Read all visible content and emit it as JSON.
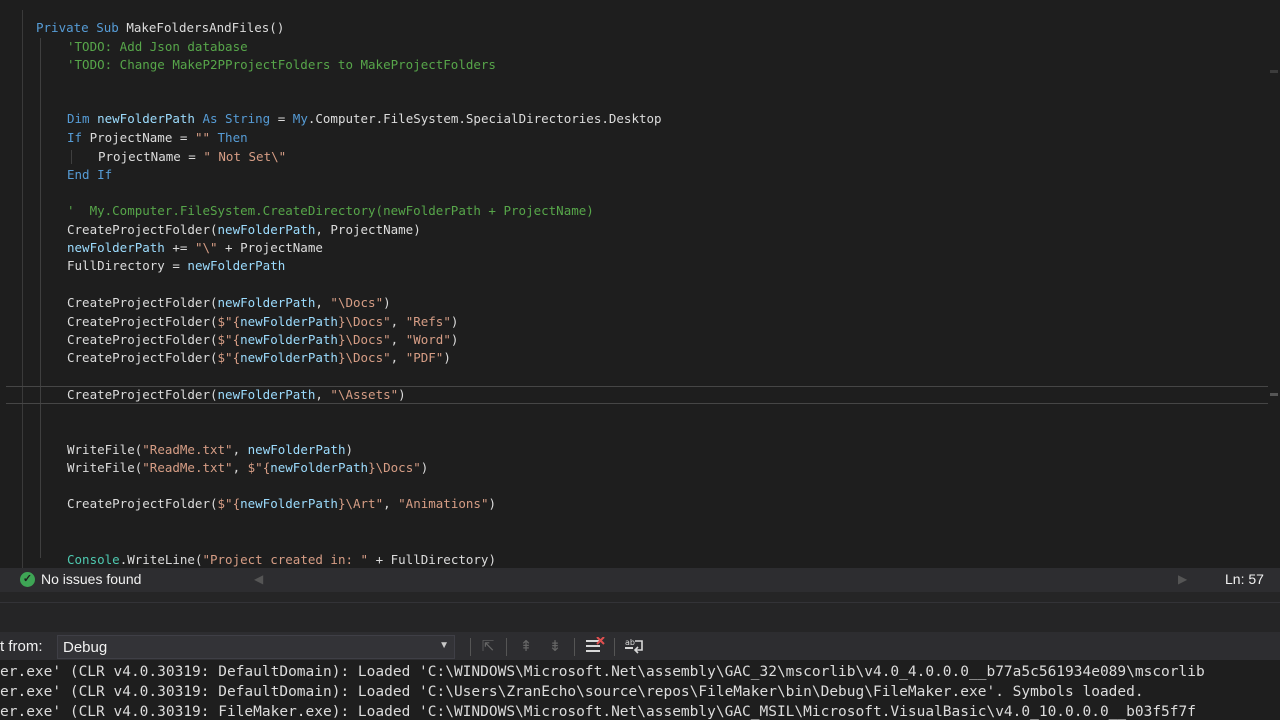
{
  "editor": {
    "lines": [
      {
        "segs": [
          [
            "kw",
            "Private Sub "
          ],
          [
            "tx",
            "MakeFoldersAndFiles()"
          ]
        ]
      },
      {
        "segs": [
          [
            "cm",
            "'TODO: Add Json database"
          ]
        ]
      },
      {
        "segs": [
          [
            "cm",
            "'TODO: Change MakeP2PProjectFolders to MakeProjectFolders"
          ]
        ]
      },
      {
        "segs": [
          [
            "kw",
            "Dim "
          ],
          [
            "id",
            "newFolderPath "
          ],
          [
            "kw",
            "As "
          ],
          [
            "kw",
            "String "
          ],
          [
            "tx",
            "= "
          ],
          [
            "kw",
            "My"
          ],
          [
            "tx",
            ".Computer.FileSystem.SpecialDirectories.Desktop"
          ]
        ]
      },
      {
        "segs": [
          [
            "kw",
            "If "
          ],
          [
            "tx",
            "ProjectName = "
          ],
          [
            "str",
            "\"\" "
          ],
          [
            "kw",
            "Then"
          ]
        ]
      },
      {
        "segs": [
          [
            "tx",
            "ProjectName = "
          ],
          [
            "str",
            "\" Not Set\\\""
          ]
        ]
      },
      {
        "segs": [
          [
            "kw",
            "End If"
          ]
        ]
      },
      {
        "segs": [
          [
            "cm",
            "'  My.Computer.FileSystem.CreateDirectory(newFolderPath + ProjectName)"
          ]
        ]
      },
      {
        "segs": [
          [
            "tx",
            "CreateProjectFolder("
          ],
          [
            "id",
            "newFolderPath"
          ],
          [
            "tx",
            ", ProjectName)"
          ]
        ]
      },
      {
        "segs": [
          [
            "id",
            "newFolderPath "
          ],
          [
            "tx",
            "+= "
          ],
          [
            "str",
            "\"\\\" "
          ],
          [
            "tx",
            "+ ProjectName"
          ]
        ]
      },
      {
        "segs": [
          [
            "tx",
            "FullDirectory = "
          ],
          [
            "id",
            "newFolderPath"
          ]
        ]
      },
      {
        "segs": [
          [
            "tx",
            "CreateProjectFolder("
          ],
          [
            "id",
            "newFolderPath"
          ],
          [
            "tx",
            ", "
          ],
          [
            "str",
            "\"\\Docs\""
          ],
          [
            "tx",
            ")"
          ]
        ]
      },
      {
        "segs": [
          [
            "tx",
            "CreateProjectFolder("
          ],
          [
            "str",
            "$\"{"
          ],
          [
            "id",
            "newFolderPath"
          ],
          [
            "str",
            "}\\Docs\""
          ],
          [
            "tx",
            ", "
          ],
          [
            "str",
            "\"Refs\""
          ],
          [
            "tx",
            ")"
          ]
        ]
      },
      {
        "segs": [
          [
            "tx",
            "CreateProjectFolder("
          ],
          [
            "str",
            "$\"{"
          ],
          [
            "id",
            "newFolderPath"
          ],
          [
            "str",
            "}\\Docs\""
          ],
          [
            "tx",
            ", "
          ],
          [
            "str",
            "\"Word\""
          ],
          [
            "tx",
            ")"
          ]
        ]
      },
      {
        "segs": [
          [
            "tx",
            "CreateProjectFolder("
          ],
          [
            "str",
            "$\"{"
          ],
          [
            "id",
            "newFolderPath"
          ],
          [
            "str",
            "}\\Docs\""
          ],
          [
            "tx",
            ", "
          ],
          [
            "str",
            "\"PDF\""
          ],
          [
            "tx",
            ")"
          ]
        ]
      },
      {
        "segs": [
          [
            "tx",
            "CreateProjectFolder("
          ],
          [
            "id",
            "newFolderPath"
          ],
          [
            "tx",
            ", "
          ],
          [
            "str",
            "\"\\Assets\""
          ],
          [
            "tx",
            ")"
          ]
        ]
      },
      {
        "segs": [
          [
            "tx",
            "WriteFile("
          ],
          [
            "str",
            "\"ReadMe.txt\""
          ],
          [
            "tx",
            ", "
          ],
          [
            "id",
            "newFolderPath"
          ],
          [
            "tx",
            ")"
          ]
        ]
      },
      {
        "segs": [
          [
            "tx",
            "WriteFile("
          ],
          [
            "str",
            "\"ReadMe.txt\""
          ],
          [
            "tx",
            ", "
          ],
          [
            "str",
            "$\"{"
          ],
          [
            "id",
            "newFolderPath"
          ],
          [
            "str",
            "}\\Docs\""
          ],
          [
            "tx",
            ")"
          ]
        ]
      },
      {
        "segs": [
          [
            "tx",
            "CreateProjectFolder("
          ],
          [
            "str",
            "$\"{"
          ],
          [
            "id",
            "newFolderPath"
          ],
          [
            "str",
            "}\\Art\""
          ],
          [
            "tx",
            ", "
          ],
          [
            "str",
            "\"Animations\""
          ],
          [
            "tx",
            ")"
          ]
        ]
      },
      {
        "segs": [
          [
            "ty",
            "Console"
          ],
          [
            "tx",
            ".WriteLine("
          ],
          [
            "str",
            "\"Project created in: \" "
          ],
          [
            "tx",
            "+ FullDirectory)"
          ]
        ]
      }
    ]
  },
  "status": {
    "issues_text": "No issues found",
    "line_label": "Ln: 57",
    "ok_icon": "check-circle-icon",
    "ok_color": "#3ea555"
  },
  "output": {
    "show_from_label": "t from:",
    "source_value": "Debug",
    "lines": [
      "er.exe' (CLR v4.0.30319: DefaultDomain): Loaded 'C:\\WINDOWS\\Microsoft.Net\\assembly\\GAC_32\\mscorlib\\v4.0_4.0.0.0__b77a5c561934e089\\mscorlib",
      "er.exe' (CLR v4.0.30319: DefaultDomain): Loaded 'C:\\Users\\ZranEcho\\source\\repos\\FileMaker\\bin\\Debug\\FileMaker.exe'. Symbols loaded.",
      "er.exe' (CLR v4.0.30319: FileMaker.exe): Loaded 'C:\\WINDOWS\\Microsoft.Net\\assembly\\GAC_MSIL\\Microsoft.VisualBasic\\v4.0_10.0.0.0__b03f5f7f"
    ],
    "toolbar_icons": [
      "go-to-location-icon",
      "previous-message-icon",
      "next-message-icon",
      "clear-all-icon",
      "word-wrap-icon"
    ]
  }
}
